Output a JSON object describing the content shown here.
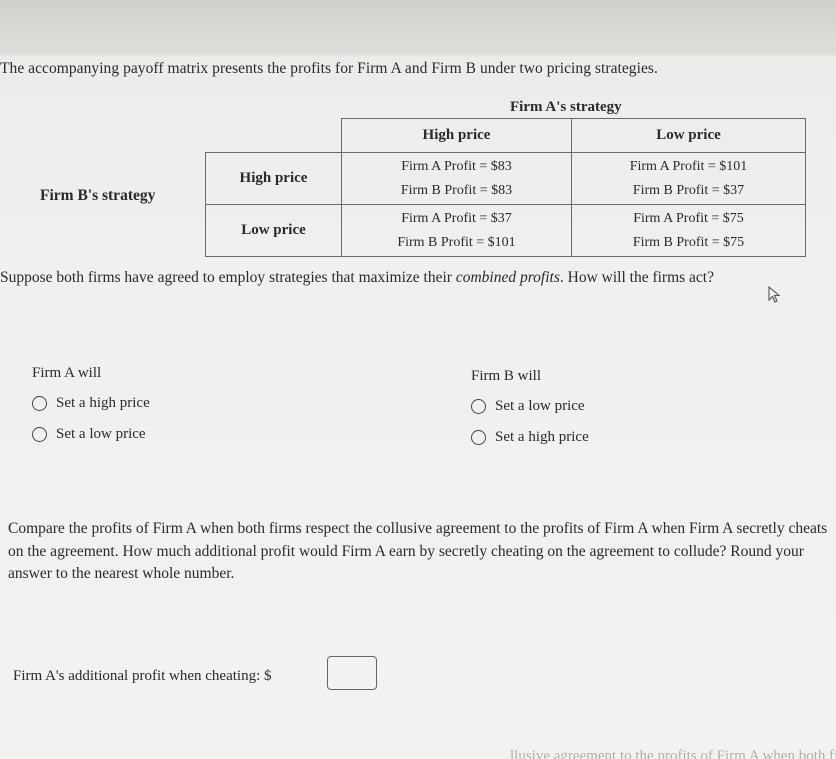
{
  "intro_text": "The accompanying payoff matrix presents the profits for Firm A and Firm B under two pricing  strategies.",
  "matrix": {
    "column_header": "Firm A's strategy",
    "row_header": "Firm B's strategy",
    "columns": [
      "High price",
      "Low price"
    ],
    "rows": [
      {
        "label": "High price",
        "cells": [
          {
            "firm_a": "Firm A Profit = $83",
            "firm_b": "Firm B Profit = $83"
          },
          {
            "firm_a": "Firm A Profit = $101",
            "firm_b": "Firm B Profit = $37"
          }
        ]
      },
      {
        "label": "Low price",
        "cells": [
          {
            "firm_a": "Firm A Profit = $37",
            "firm_b": "Firm B Profit = $101"
          },
          {
            "firm_a": "Firm A Profit = $75",
            "firm_b": "Firm B Profit = $75"
          }
        ]
      }
    ]
  },
  "question1": {
    "before_em": "Suppose both firms have agreed to employ strategies that maximize their ",
    "em": "combined profits",
    "after_em": ". How will the firms act?"
  },
  "firm_a_group": {
    "label": "Firm A will",
    "options": [
      "Set a high price",
      "Set a low price"
    ],
    "selected": null
  },
  "firm_b_group": {
    "label": "Firm B will",
    "options": [
      "Set a low price",
      "Set a high price"
    ],
    "selected": null
  },
  "question2": "Compare the profits of Firm A when both firms respect the collusive agreement to the profits of Firm A when Firm A secretly cheats on the agreement. How much additional profit would Firm A earn by secretly cheating on the agreement to collude? Round your answer to the nearest whole number.",
  "answer": {
    "label": "Firm A's additional profit when cheating: $",
    "value": ""
  },
  "bottom_partial_text": "llusive agreement to the profits of Firm A when both firms cheat"
}
